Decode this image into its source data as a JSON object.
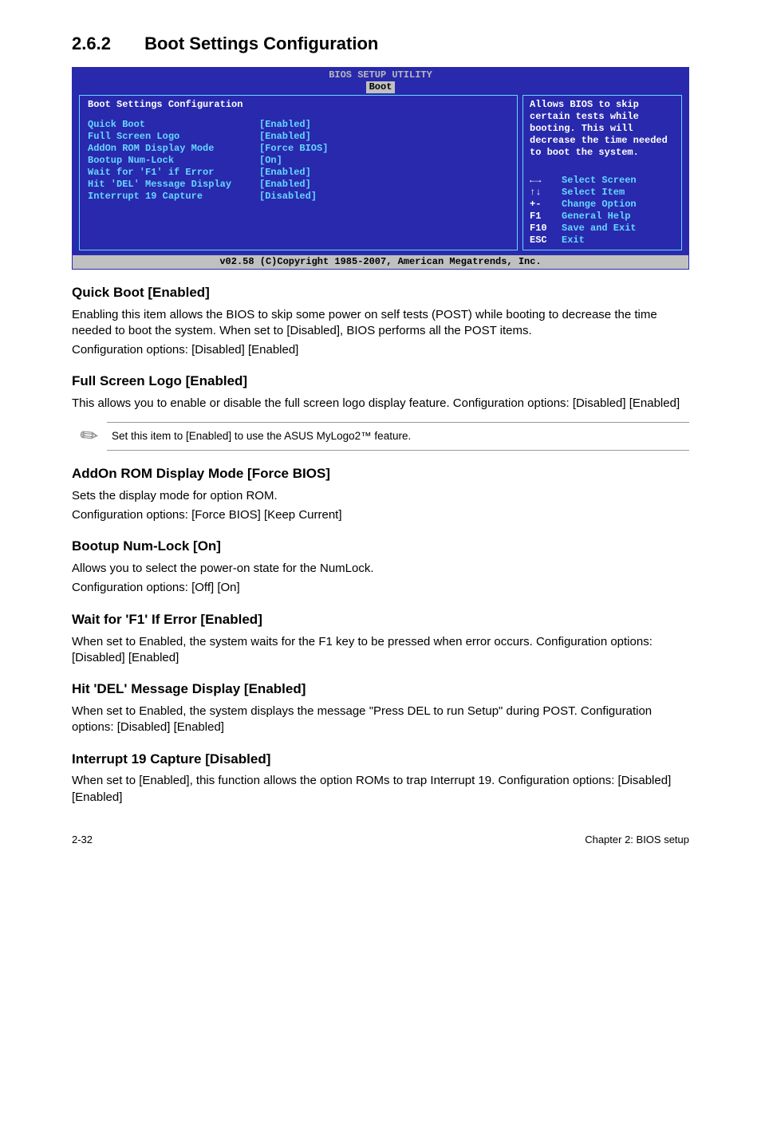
{
  "section": {
    "number": "2.6.2",
    "title": "Boot Settings Configuration"
  },
  "bios": {
    "title": "BIOS SETUP UTILITY",
    "active_tab": "Boot",
    "panel_header": "Boot Settings Configuration",
    "rows": [
      {
        "label": "Quick Boot",
        "value": "[Enabled]"
      },
      {
        "label": "Full Screen Logo",
        "value": "[Enabled]"
      },
      {
        "label": "AddOn ROM Display Mode",
        "value": "[Force BIOS]"
      },
      {
        "label": "Bootup Num-Lock",
        "value": "[On]"
      },
      {
        "label": "Wait for 'F1' if Error",
        "value": "[Enabled]"
      },
      {
        "label": "Hit 'DEL' Message Display",
        "value": "[Enabled]"
      },
      {
        "label": "Interrupt 19 Capture",
        "value": "[Disabled]"
      }
    ],
    "help": "Allows BIOS to skip certain tests while booting. This will decrease the time needed to boot the system.",
    "keys": [
      {
        "key": "←→",
        "desc": "Select Screen",
        "arrows": true
      },
      {
        "key": "↑↓",
        "desc": "Select Item",
        "arrows": true
      },
      {
        "key": "+-",
        "desc": "Change Option"
      },
      {
        "key": "F1",
        "desc": "General Help"
      },
      {
        "key": "F10",
        "desc": "Save and Exit"
      },
      {
        "key": "ESC",
        "desc": "Exit"
      }
    ],
    "footer": "v02.58 (C)Copyright 1985-2007, American Megatrends, Inc."
  },
  "items": {
    "quick_boot": {
      "heading": "Quick Boot [Enabled]",
      "body1": "Enabling this item allows the BIOS to skip some power on self tests (POST) while booting to decrease the time needed to boot the system. When set to [Disabled], BIOS performs all the POST items.",
      "body2": "Configuration options: [Disabled] [Enabled]"
    },
    "full_screen_logo": {
      "heading": "Full Screen Logo [Enabled]",
      "body1": "This allows you to enable or disable the full screen logo display feature. Configuration options: [Disabled] [Enabled]"
    },
    "note": "Set this item to [Enabled] to use the ASUS MyLogo2™ feature.",
    "addon_rom": {
      "heading": "AddOn ROM Display Mode [Force BIOS]",
      "body1": "Sets the display mode for option ROM.",
      "body2": "Configuration options: [Force BIOS] [Keep Current]"
    },
    "numlock": {
      "heading": "Bootup Num-Lock [On]",
      "body1": "Allows you to select the power-on state for the NumLock.",
      "body2": "Configuration options: [Off] [On]"
    },
    "wait_f1": {
      "heading": "Wait for 'F1' If Error [Enabled]",
      "body1": "When set to Enabled, the system waits for the F1 key to be pressed when error occurs. Configuration options: [Disabled] [Enabled]"
    },
    "hit_del": {
      "heading": "Hit 'DEL' Message Display [Enabled]",
      "body1": "When set to Enabled, the system displays the message \"Press DEL to run Setup\" during POST. Configuration options: [Disabled] [Enabled]"
    },
    "int19": {
      "heading": "Interrupt 19 Capture [Disabled]",
      "body1": "When set to [Enabled], this function allows the option ROMs to trap Interrupt 19. Configuration options: [Disabled] [Enabled]"
    }
  },
  "footer": {
    "left": "2-32",
    "right": "Chapter 2: BIOS setup"
  }
}
